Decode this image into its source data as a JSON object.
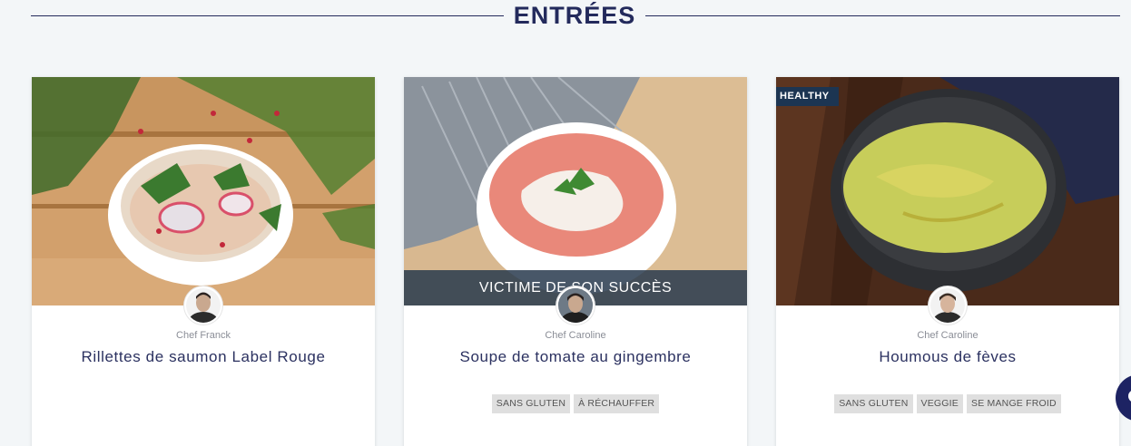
{
  "section": {
    "title": "ENTRÉES"
  },
  "cards": [
    {
      "chef": "Chef Franck",
      "title": "Rillettes de saumon Label Rouge",
      "tags": []
    },
    {
      "banner": "VICTIME DE SON SUCCÈS",
      "chef": "Chef Caroline",
      "title": "Soupe de tomate au gingembre",
      "tags": [
        "SANS GLUTEN",
        "À RÉCHAUFFER"
      ]
    },
    {
      "badge": "HEALTHY",
      "chef": "Chef Caroline",
      "title": "Houmous de fèves",
      "tags": [
        "SANS GLUTEN",
        "VEGGIE",
        "SE MANGE FROID"
      ]
    }
  ],
  "icons": {
    "chat": "chat-icon"
  },
  "colors": {
    "navy": "#232a5c",
    "banner": "#283a4e",
    "badge": "#1c3552",
    "tag_bg": "#dfdfdf"
  }
}
